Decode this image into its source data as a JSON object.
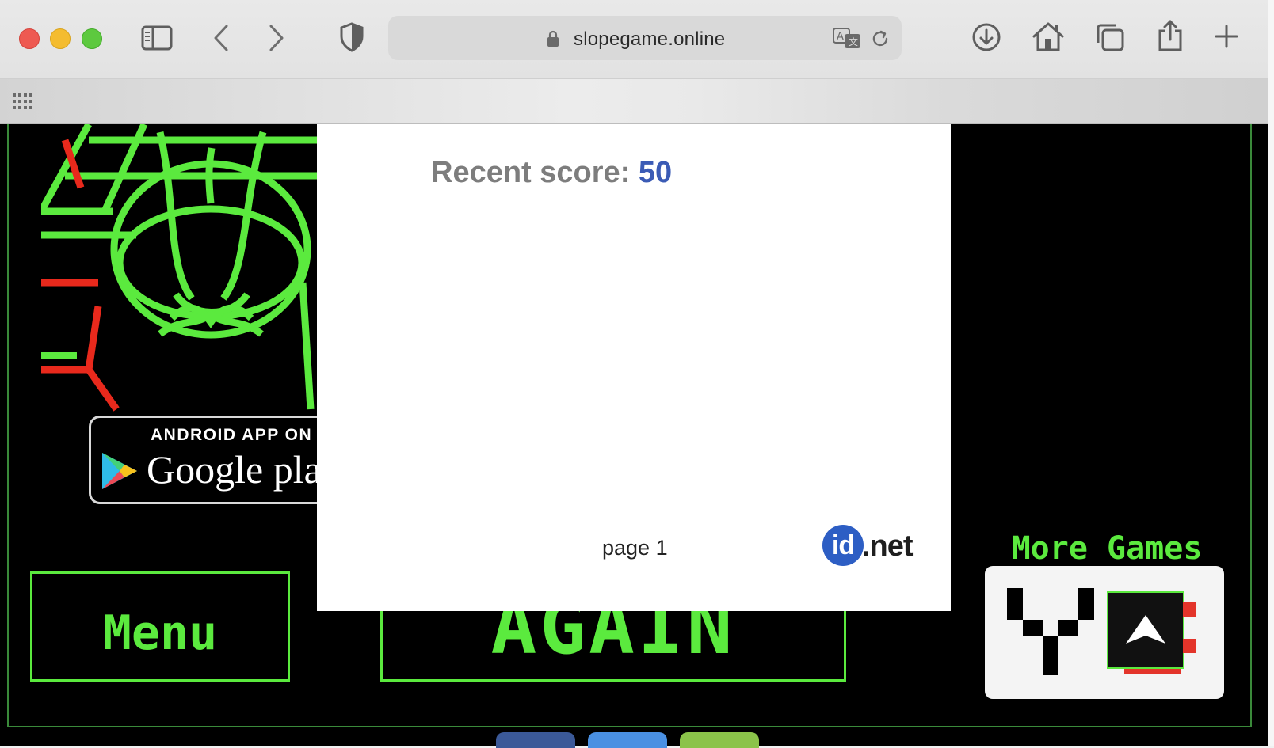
{
  "browser": {
    "url": "slopegame.online",
    "traffic_lights": {
      "close": "#ee5a52",
      "minimize": "#f4bc2f",
      "maximize": "#5dc93f"
    },
    "icons": [
      "sidebar-icon",
      "back-icon",
      "forward-icon",
      "shield-icon",
      "lock-icon",
      "translate-icon",
      "reload-icon",
      "download-icon",
      "home-icon",
      "tabs-icon",
      "share-icon",
      "plus-icon",
      "grid-icon"
    ]
  },
  "game": {
    "accent_color": "#5bea3e",
    "google_play": {
      "top": "ANDROID APP ON",
      "main": "Google play"
    },
    "menu_label": "Menu",
    "again_label": "AGAIN",
    "more_games_label": "More Games"
  },
  "panel": {
    "score_label": "Recent score:",
    "score_value": "50",
    "page_label": "page 1",
    "brand_id": "id",
    "brand_net": ".net"
  },
  "share_colors": [
    "#3b5998",
    "#4a90e2",
    "#8bc34a"
  ]
}
